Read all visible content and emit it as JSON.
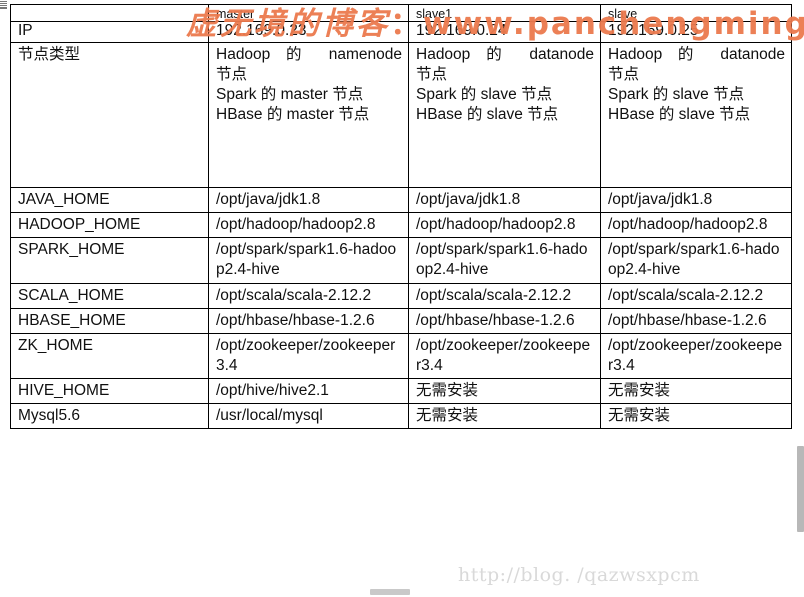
{
  "table": {
    "columns": [
      "",
      "master",
      "slave1",
      "slave"
    ],
    "rows": [
      {
        "label": "",
        "master": "master",
        "slave1": "slave1",
        "slave": "slave",
        "kind": "header"
      },
      {
        "label": "IP",
        "master": "192.169.0.23",
        "slave1": "192.169.0.24",
        "slave": "192.169.0.25",
        "kind": "ip"
      },
      {
        "label": "节点类型",
        "kind": "nodetype",
        "master_lines": [
          "Hadoop 的 namenode",
          "节点",
          "Spark 的 master 节点",
          "HBase 的 master 节点"
        ],
        "slave1_lines": [
          "Hadoop 的 datanode",
          "节点",
          "Spark 的 slave 节点",
          "HBase 的 slave 节点"
        ],
        "slave_lines": [
          "Hadoop 的 datanode",
          "节点",
          "Spark 的 slave 节点",
          "HBase 的 slave 节点"
        ]
      },
      {
        "label": "JAVA_HOME",
        "master": "/opt/java/jdk1.8",
        "slave1": "/opt/java/jdk1.8",
        "slave": "/opt/java/jdk1.8",
        "kind": "path"
      },
      {
        "label": "HADOOP_HOME",
        "master": "/opt/hadoop/hadoop2.8",
        "slave1": "/opt/hadoop/hadoop2.8",
        "slave": "/opt/hadoop/hadoop2.8",
        "kind": "path"
      },
      {
        "label": "SPARK_HOME",
        "master": "/opt/spark/spark1.6-hadoop2.4-hive",
        "slave1": "/opt/spark/spark1.6-hadoop2.4-hive",
        "slave": "/opt/spark/spark1.6-hadoop2.4-hive",
        "kind": "path"
      },
      {
        "label": "SCALA_HOME",
        "master": "/opt/scala/scala-2.12.2",
        "slave1": "/opt/scala/scala-2.12.2",
        "slave": "/opt/scala/scala-2.12.2",
        "kind": "path"
      },
      {
        "label": "HBASE_HOME",
        "master": "/opt/hbase/hbase-1.2.6",
        "slave1": "/opt/hbase/hbase-1.2.6",
        "slave": "/opt/hbase/hbase-1.2.6",
        "kind": "path"
      },
      {
        "label": "ZK_HOME",
        "master": "/opt/zookeeper/zookeeper3.4",
        "slave1": "/opt/zookeeper/zookeeper3.4",
        "slave": "/opt/zookeeper/zookeeper3.4",
        "kind": "path"
      },
      {
        "label": "HIVE_HOME",
        "master": "/opt/hive/hive2.1",
        "slave1": "无需安装",
        "slave": "无需安装",
        "kind": "path"
      },
      {
        "label": "Mysql5.6",
        "master": "/usr/local/mysql",
        "slave1": "无需安装",
        "slave": "无需安装",
        "kind": "path"
      }
    ]
  },
  "watermarks": {
    "top_cjk": "虚无境的博客",
    "top_ascii": "：www.panchengming.com",
    "top_color": "#ec7a4e",
    "bottom": "http://blog.           /qazwsxpcm",
    "bottom_color": "#d9d9d9"
  }
}
